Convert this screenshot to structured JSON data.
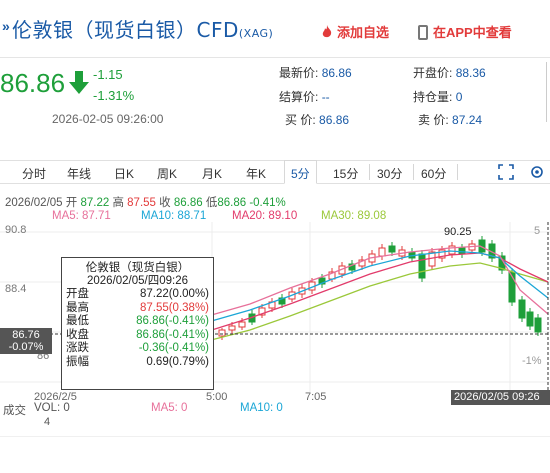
{
  "header": {
    "title": "伦敦银（现货白银）CFD",
    "title_sub": "(XAG)",
    "add_fav": "添加自选",
    "app_check": "在APP中查看"
  },
  "quote": {
    "price": "86.86",
    "change": "-1.15",
    "change_pct": "-1.31%",
    "time": "2026-02-05 09:26:00"
  },
  "info": {
    "latest_label": "最新价:",
    "latest": "86.86",
    "open_label": "开盘价:",
    "open": "88.36",
    "settle_label": "结算价:",
    "settle": "--",
    "position_label": "持仓量:",
    "position": "0",
    "buy_label": "买  价:",
    "buy": "86.86",
    "sell_label": "卖  价:",
    "sell": "87.24"
  },
  "tabs": [
    "分时",
    "年线",
    "日K",
    "周K",
    "月K",
    "年K",
    "5分",
    "15分",
    "30分",
    "60分"
  ],
  "active_tab": "5分",
  "ohlc_line": {
    "date": "2026/02/05",
    "open_label": "开",
    "open": "87.22",
    "high_label": "高",
    "high": "87.55",
    "close_label": "收",
    "close": "86.86",
    "low_label": "低",
    "low": "86.86",
    "pct": "-0.41%"
  },
  "ma": {
    "ma5": "MA5: 87.71",
    "ma10": "MA10: 88.71",
    "ma20": "MA20: 89.10",
    "ma30": "MA30: 89.08"
  },
  "axis": {
    "y_top": "90.8",
    "y_mid": "88.4",
    "y_low": "86",
    "right_top": "5",
    "right_low": "-1%",
    "x_start": "2026/2/5",
    "x_mid1": "5:00",
    "x_mid2": "7:05",
    "peak": "90.25"
  },
  "crosshair": {
    "price": "86.76",
    "pct": "-0.07%",
    "time": "2026/02/05 09:26"
  },
  "tooltip": {
    "title": "伦敦银（现货白银）",
    "datetime": "2026/02/05/四09:26",
    "rows": [
      {
        "label": "开盘",
        "value": "87.22(0.00%)",
        "color": "#222222"
      },
      {
        "label": "最高",
        "value": "87.55(0.38%)",
        "color": "#e23b3b"
      },
      {
        "label": "最低",
        "value": "86.86(-0.41%)",
        "color": "#1e9f3a"
      },
      {
        "label": "收盘",
        "value": "86.86(-0.41%)",
        "color": "#1e9f3a"
      },
      {
        "label": "涨跌",
        "value": "-0.36(-0.41%)",
        "color": "#1e9f3a"
      },
      {
        "label": "振幅",
        "value": "0.69(0.79%)",
        "color": "#222222"
      }
    ]
  },
  "volume": {
    "label": "成交",
    "count": "4",
    "vol": "VOL: 0",
    "ma5": "MA5: 0",
    "ma10": "MA10: 0"
  },
  "colors": {
    "up": "#e23b3b",
    "down": "#1e9f3a",
    "brand": "#1a5aa6",
    "ma5": "#e7709a",
    "ma10": "#1ba6d6",
    "ma20": "#e23b6b",
    "ma30": "#9bc83a"
  }
}
